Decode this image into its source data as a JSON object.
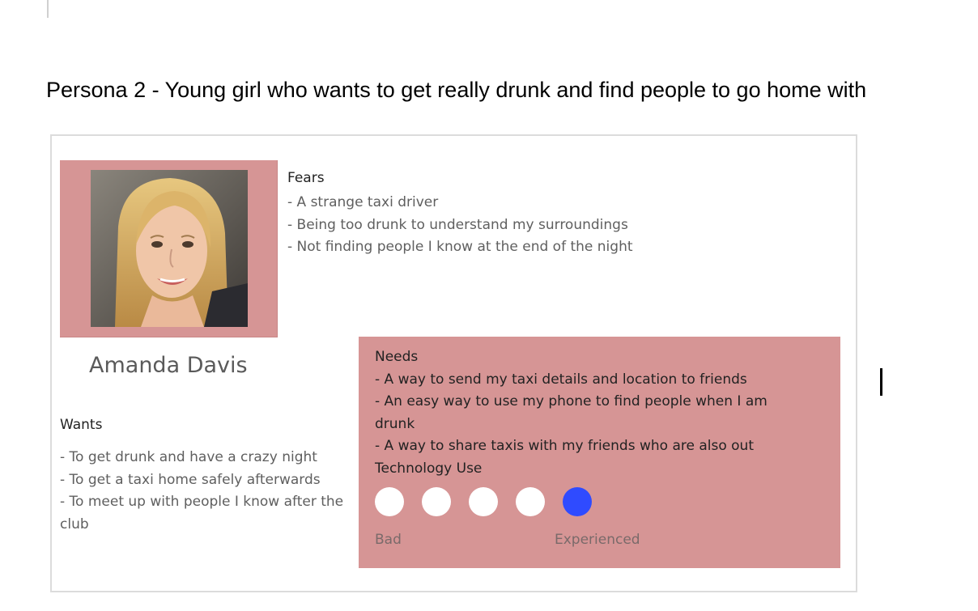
{
  "heading": "Persona 2 - Young girl who wants to get really drunk and find people to go home with",
  "persona": {
    "name": "Amanda Davis",
    "photo_alt": "Portrait of a smiling young woman with long blonde hair"
  },
  "fears": {
    "title": "Fears",
    "items": [
      "- A strange taxi driver",
      "- Being too drunk to understand my surroundings",
      "- Not finding people I know at the end of the night"
    ]
  },
  "wants": {
    "title": "Wants",
    "items": [
      "- To get drunk and have a crazy night",
      "- To get a taxi home safely afterwards",
      "- To meet up with people I know after the club"
    ]
  },
  "needs": {
    "title": "Needs",
    "items": [
      "- A way to send my taxi details and location to friends",
      "- An easy way to use my phone to find people when I am drunk",
      "- A way to share taxis with my friends who are also out"
    ]
  },
  "technology": {
    "title": "Technology Use",
    "level": 5,
    "max": 5,
    "low_label": "Bad",
    "high_label": "Experienced"
  },
  "colors": {
    "panel": "#d69595",
    "selected_dot": "#2f4bff",
    "empty_dot": "#ffffff"
  }
}
